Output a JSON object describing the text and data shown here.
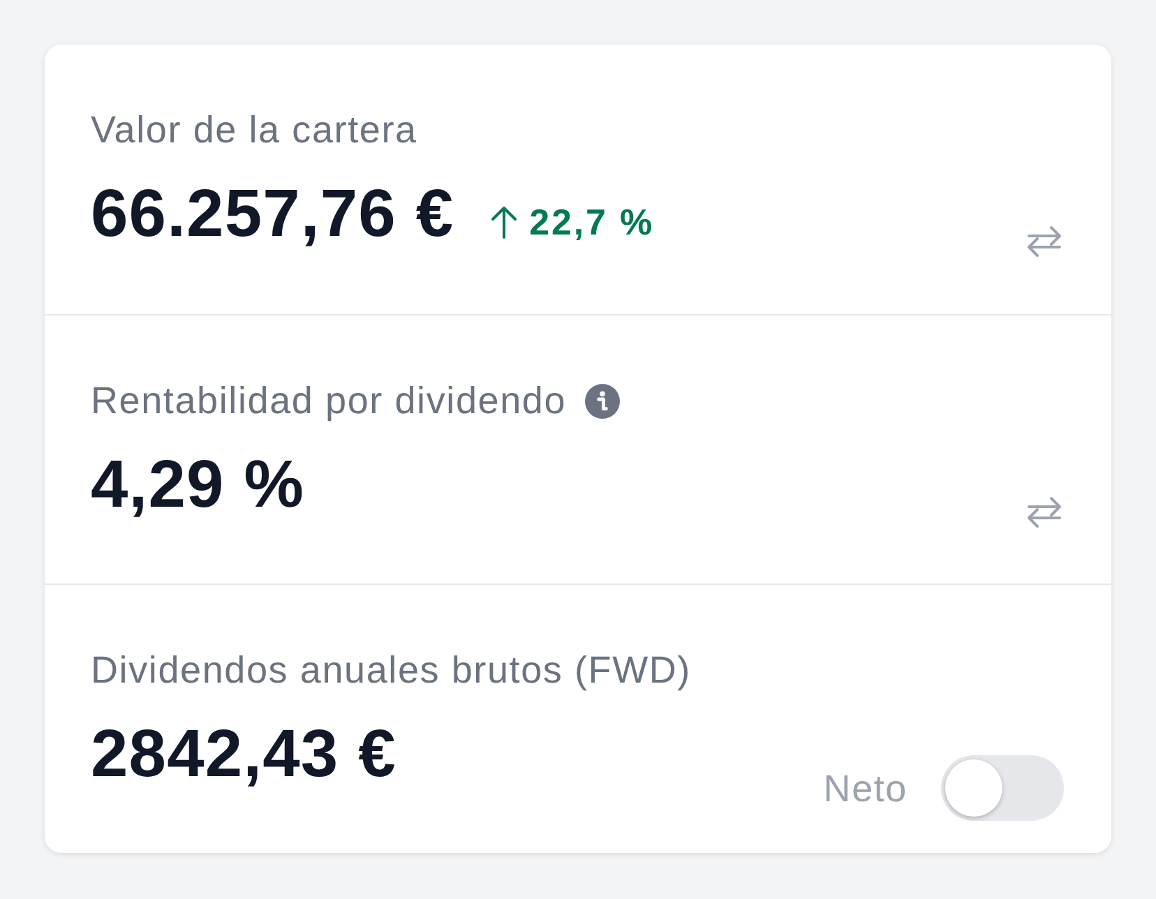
{
  "metrics": [
    {
      "kind": "total",
      "label": "Valor de la cartera",
      "value": "66.257,76 €",
      "change": {
        "up": true,
        "text": "22,7 %"
      }
    },
    {
      "kind": "yield",
      "label": "Rentabilidad por dividendo",
      "value": "4,29 %"
    },
    {
      "kind": "dividends",
      "label": "Dividendos anuales brutos (FWD)",
      "value": "2842,43 €",
      "toggle": {
        "label": "Neto",
        "on": false
      }
    }
  ]
}
